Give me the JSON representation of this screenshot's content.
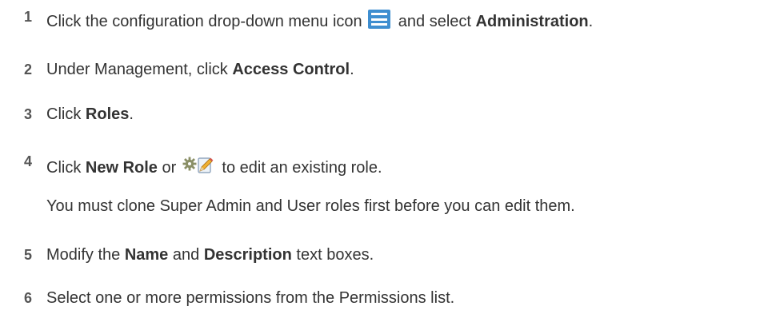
{
  "steps": [
    {
      "number": "1",
      "pre": "Click the configuration drop-down menu icon",
      "mid": "and select",
      "bold": "Administration",
      "post": "."
    },
    {
      "number": "2",
      "pre": "Under Management, click",
      "bold": "Access Control",
      "post": "."
    },
    {
      "number": "3",
      "pre": "Click",
      "bold": "Roles",
      "post": "."
    },
    {
      "number": "4",
      "pre": "Click",
      "bold": "New Role",
      "mid": "or",
      "post": "to edit an existing role.",
      "note": "You must clone Super Admin and User roles first before you can edit them."
    },
    {
      "number": "5",
      "pre": "Modify the",
      "bold1": "Name",
      "mid": "and",
      "bold2": "Description",
      "post": "text boxes."
    },
    {
      "number": "6",
      "text": "Select one or more permissions from the Permissions list."
    }
  ],
  "icons": {
    "menu": "hamburger-menu-icon",
    "gear": "gear-icon",
    "edit": "pencil-edit-icon"
  },
  "colors": {
    "menu_icon_bg": "#3e8ed0",
    "text": "#333333",
    "number": "#555555"
  }
}
